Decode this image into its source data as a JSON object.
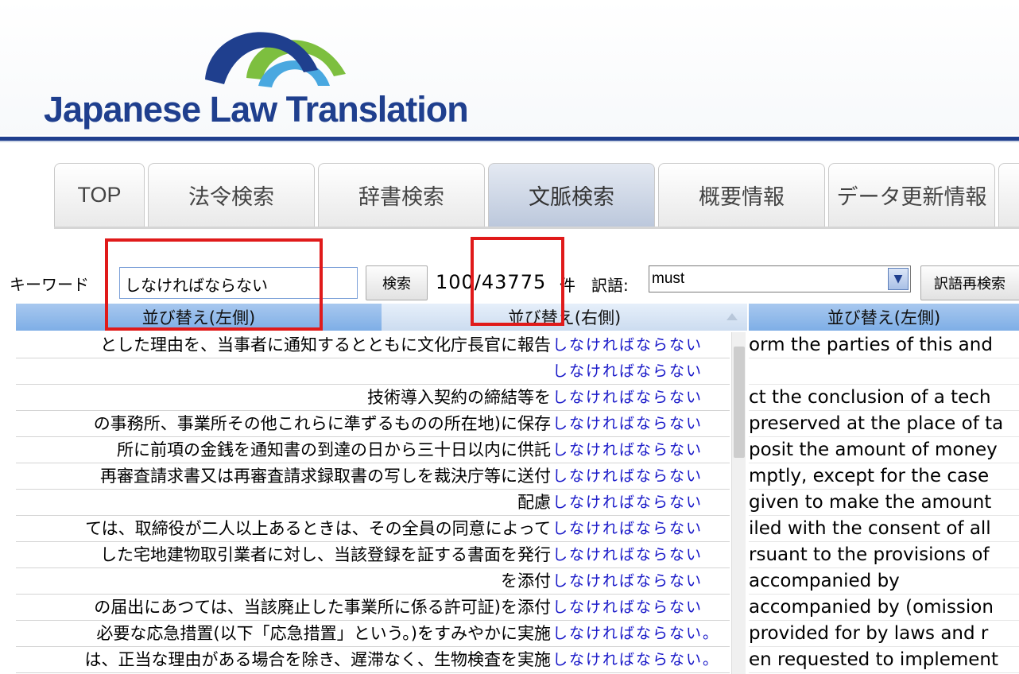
{
  "site": {
    "logo_text": "Japanese Law Translation"
  },
  "tabs": [
    {
      "label": "TOP"
    },
    {
      "label": "法令検索"
    },
    {
      "label": "辞書検索"
    },
    {
      "label": "文脈検索"
    },
    {
      "label": "概要情報"
    },
    {
      "label": "データ更新情報"
    }
  ],
  "active_tab": "文脈検索",
  "search": {
    "keyword_label": "キーワード",
    "keyword_value": "しなければならない",
    "search_button": "検索",
    "count": "100/43775",
    "count_unit": "件",
    "translation_label": "訳語:",
    "translation_value": "must",
    "research_button": "訳語再検索"
  },
  "table": {
    "headers": {
      "left": "並び替え(左側)",
      "middle": "並び替え(右側)",
      "right": "並び替え(左側)"
    },
    "rows": [
      {
        "jp": "とした理由を、当事者に通知するとともに文化庁長官に報告",
        "kw": "しなければならない",
        "en": "orm the parties of this and"
      },
      {
        "jp": "",
        "kw": "しなければならない",
        "en": ""
      },
      {
        "jp": "技術導入契約の締結等を",
        "kw": "しなければならない",
        "en": "ct the conclusion of a tech"
      },
      {
        "jp": "の事務所、事業所その他これらに準ずるものの所在地)に保存",
        "kw": "しなければならない",
        "en": "preserved at the place of ta"
      },
      {
        "jp": "所に前項の金銭を通知書の到達の日から三十日以内に供託",
        "kw": "しなければならない",
        "en": "posit the amount of money"
      },
      {
        "jp": "再審査請求書又は再審査請求録取書の写しを裁決庁等に送付",
        "kw": "しなければならない",
        "en": "mptly, except for the case"
      },
      {
        "jp": "配慮",
        "kw": "しなければならない",
        "en": "given to make the amount"
      },
      {
        "jp": "ては、取締役が二人以上あるときは、その全員の同意によって",
        "kw": "しなければならない",
        "en": "iled with the consent of all"
      },
      {
        "jp": "した宅地建物取引業者に対し、当該登録を証する書面を発行",
        "kw": "しなければならない",
        "en": "rsuant to the provisions of"
      },
      {
        "jp": "を添付",
        "kw": "しなければならない",
        "en": "accompanied by"
      },
      {
        "jp": "の届出にあつては、当該廃止した事業所に係る許可証)を添付",
        "kw": "しなければならない",
        "en": "accompanied by (omission"
      },
      {
        "jp": "必要な応急措置(以下「応急措置」という。)をすみやかに実施",
        "kw": "しなければならない。",
        "en": "provided for by laws and r"
      },
      {
        "jp": "は、正当な理由がある場合を除き、遅滞なく、生物検査を実施",
        "kw": "しなければならない。",
        "en": "en requested to implement"
      }
    ]
  },
  "colors": {
    "brand": "#1f3f8e",
    "keyword": "#1717c8",
    "highlight_box": "#e01a1a"
  }
}
